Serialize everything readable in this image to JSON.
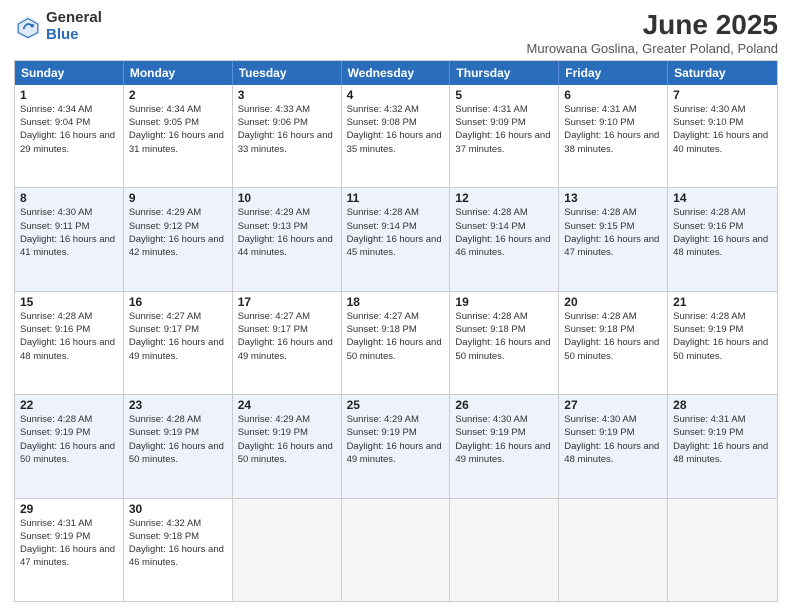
{
  "header": {
    "logo_general": "General",
    "logo_blue": "Blue",
    "month_title": "June 2025",
    "subtitle": "Murowana Goslina, Greater Poland, Poland"
  },
  "weekdays": [
    "Sunday",
    "Monday",
    "Tuesday",
    "Wednesday",
    "Thursday",
    "Friday",
    "Saturday"
  ],
  "rows": [
    [
      {
        "day": "",
        "empty": true
      },
      {
        "day": "2",
        "rise": "Sunrise: 4:34 AM",
        "set": "Sunset: 9:05 PM",
        "daylight": "Daylight: 16 hours and 31 minutes."
      },
      {
        "day": "3",
        "rise": "Sunrise: 4:33 AM",
        "set": "Sunset: 9:06 PM",
        "daylight": "Daylight: 16 hours and 33 minutes."
      },
      {
        "day": "4",
        "rise": "Sunrise: 4:32 AM",
        "set": "Sunset: 9:08 PM",
        "daylight": "Daylight: 16 hours and 35 minutes."
      },
      {
        "day": "5",
        "rise": "Sunrise: 4:31 AM",
        "set": "Sunset: 9:09 PM",
        "daylight": "Daylight: 16 hours and 37 minutes."
      },
      {
        "day": "6",
        "rise": "Sunrise: 4:31 AM",
        "set": "Sunset: 9:10 PM",
        "daylight": "Daylight: 16 hours and 38 minutes."
      },
      {
        "day": "7",
        "rise": "Sunrise: 4:30 AM",
        "set": "Sunset: 9:10 PM",
        "daylight": "Daylight: 16 hours and 40 minutes."
      }
    ],
    [
      {
        "day": "8",
        "rise": "Sunrise: 4:30 AM",
        "set": "Sunset: 9:11 PM",
        "daylight": "Daylight: 16 hours and 41 minutes."
      },
      {
        "day": "9",
        "rise": "Sunrise: 4:29 AM",
        "set": "Sunset: 9:12 PM",
        "daylight": "Daylight: 16 hours and 42 minutes."
      },
      {
        "day": "10",
        "rise": "Sunrise: 4:29 AM",
        "set": "Sunset: 9:13 PM",
        "daylight": "Daylight: 16 hours and 44 minutes."
      },
      {
        "day": "11",
        "rise": "Sunrise: 4:28 AM",
        "set": "Sunset: 9:14 PM",
        "daylight": "Daylight: 16 hours and 45 minutes."
      },
      {
        "day": "12",
        "rise": "Sunrise: 4:28 AM",
        "set": "Sunset: 9:14 PM",
        "daylight": "Daylight: 16 hours and 46 minutes."
      },
      {
        "day": "13",
        "rise": "Sunrise: 4:28 AM",
        "set": "Sunset: 9:15 PM",
        "daylight": "Daylight: 16 hours and 47 minutes."
      },
      {
        "day": "14",
        "rise": "Sunrise: 4:28 AM",
        "set": "Sunset: 9:16 PM",
        "daylight": "Daylight: 16 hours and 48 minutes."
      }
    ],
    [
      {
        "day": "15",
        "rise": "Sunrise: 4:28 AM",
        "set": "Sunset: 9:16 PM",
        "daylight": "Daylight: 16 hours and 48 minutes."
      },
      {
        "day": "16",
        "rise": "Sunrise: 4:27 AM",
        "set": "Sunset: 9:17 PM",
        "daylight": "Daylight: 16 hours and 49 minutes."
      },
      {
        "day": "17",
        "rise": "Sunrise: 4:27 AM",
        "set": "Sunset: 9:17 PM",
        "daylight": "Daylight: 16 hours and 49 minutes."
      },
      {
        "day": "18",
        "rise": "Sunrise: 4:27 AM",
        "set": "Sunset: 9:18 PM",
        "daylight": "Daylight: 16 hours and 50 minutes."
      },
      {
        "day": "19",
        "rise": "Sunrise: 4:28 AM",
        "set": "Sunset: 9:18 PM",
        "daylight": "Daylight: 16 hours and 50 minutes."
      },
      {
        "day": "20",
        "rise": "Sunrise: 4:28 AM",
        "set": "Sunset: 9:18 PM",
        "daylight": "Daylight: 16 hours and 50 minutes."
      },
      {
        "day": "21",
        "rise": "Sunrise: 4:28 AM",
        "set": "Sunset: 9:19 PM",
        "daylight": "Daylight: 16 hours and 50 minutes."
      }
    ],
    [
      {
        "day": "22",
        "rise": "Sunrise: 4:28 AM",
        "set": "Sunset: 9:19 PM",
        "daylight": "Daylight: 16 hours and 50 minutes."
      },
      {
        "day": "23",
        "rise": "Sunrise: 4:28 AM",
        "set": "Sunset: 9:19 PM",
        "daylight": "Daylight: 16 hours and 50 minutes."
      },
      {
        "day": "24",
        "rise": "Sunrise: 4:29 AM",
        "set": "Sunset: 9:19 PM",
        "daylight": "Daylight: 16 hours and 50 minutes."
      },
      {
        "day": "25",
        "rise": "Sunrise: 4:29 AM",
        "set": "Sunset: 9:19 PM",
        "daylight": "Daylight: 16 hours and 49 minutes."
      },
      {
        "day": "26",
        "rise": "Sunrise: 4:30 AM",
        "set": "Sunset: 9:19 PM",
        "daylight": "Daylight: 16 hours and 49 minutes."
      },
      {
        "day": "27",
        "rise": "Sunrise: 4:30 AM",
        "set": "Sunset: 9:19 PM",
        "daylight": "Daylight: 16 hours and 48 minutes."
      },
      {
        "day": "28",
        "rise": "Sunrise: 4:31 AM",
        "set": "Sunset: 9:19 PM",
        "daylight": "Daylight: 16 hours and 48 minutes."
      }
    ],
    [
      {
        "day": "29",
        "rise": "Sunrise: 4:31 AM",
        "set": "Sunset: 9:19 PM",
        "daylight": "Daylight: 16 hours and 47 minutes."
      },
      {
        "day": "30",
        "rise": "Sunrise: 4:32 AM",
        "set": "Sunset: 9:18 PM",
        "daylight": "Daylight: 16 hours and 46 minutes."
      },
      {
        "day": "",
        "empty": true
      },
      {
        "day": "",
        "empty": true
      },
      {
        "day": "",
        "empty": true
      },
      {
        "day": "",
        "empty": true
      },
      {
        "day": "",
        "empty": true
      }
    ]
  ],
  "row0_day1": {
    "day": "1",
    "rise": "Sunrise: 4:34 AM",
    "set": "Sunset: 9:04 PM",
    "daylight": "Daylight: 16 hours and 29 minutes."
  }
}
